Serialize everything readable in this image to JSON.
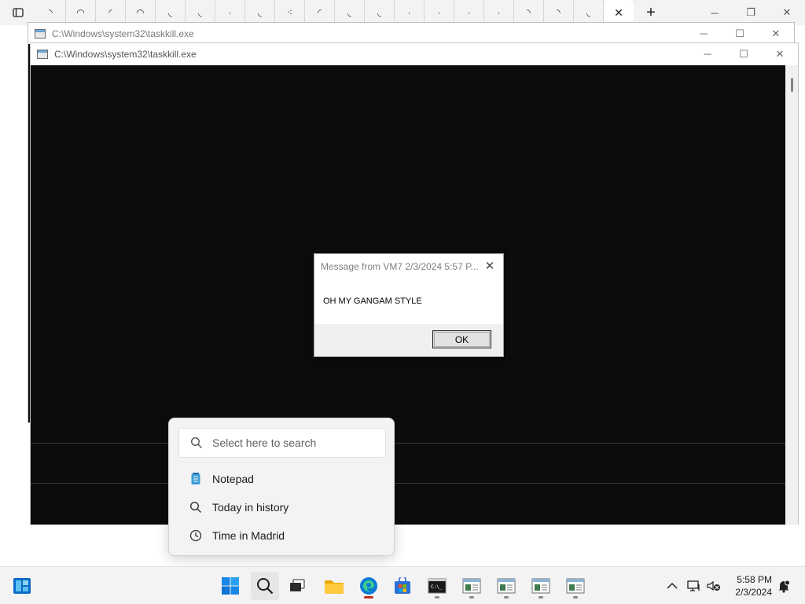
{
  "browser": {
    "tab_count_visible": 20,
    "active_tab_close": "✕",
    "new_tab": "+",
    "window_controls": {
      "minimize": "─",
      "restore": "❐",
      "close": "✕"
    }
  },
  "back_window": {
    "title": "C:\\Windows\\system32\\taskkill.exe",
    "controls": {
      "minimize": "─",
      "maximize": "☐",
      "close": "✕"
    }
  },
  "front_window": {
    "title": "C:\\Windows\\system32\\taskkill.exe",
    "controls": {
      "minimize": "─",
      "maximize": "☐",
      "close": "✕"
    }
  },
  "message_box": {
    "title": "Message from VM7 2/3/2024 5:57 P...",
    "message": "OH MY GANGAM STYLE",
    "ok_label": "OK",
    "close": "✕"
  },
  "search_flyout": {
    "placeholder": "Select here to search",
    "results": [
      {
        "label": "Notepad",
        "icon": "notepad-icon"
      },
      {
        "label": "Today in history",
        "icon": "search-icon"
      },
      {
        "label": "Time in Madrid",
        "icon": "clock-icon"
      }
    ]
  },
  "taskbar": {
    "apps": [
      {
        "name": "widgets",
        "icon": "widgets-icon"
      },
      {
        "name": "start",
        "icon": "windows-start-icon"
      },
      {
        "name": "search",
        "icon": "search-icon"
      },
      {
        "name": "task-view",
        "icon": "task-view-icon"
      },
      {
        "name": "file-explorer",
        "icon": "folder-icon"
      },
      {
        "name": "edge",
        "icon": "edge-icon"
      },
      {
        "name": "store",
        "icon": "store-icon"
      },
      {
        "name": "terminal",
        "icon": "terminal-icon"
      },
      {
        "name": "console-1",
        "icon": "console-window-icon"
      },
      {
        "name": "console-2",
        "icon": "console-window-icon"
      },
      {
        "name": "console-3",
        "icon": "console-window-icon"
      },
      {
        "name": "console-4",
        "icon": "console-window-icon"
      }
    ],
    "tray": {
      "chevron": "^"
    },
    "clock": {
      "time": "5:58 PM",
      "date": "2/3/2024"
    },
    "colors": {
      "accent": "#0078d4",
      "active_indicator": "#c42b1c"
    }
  }
}
